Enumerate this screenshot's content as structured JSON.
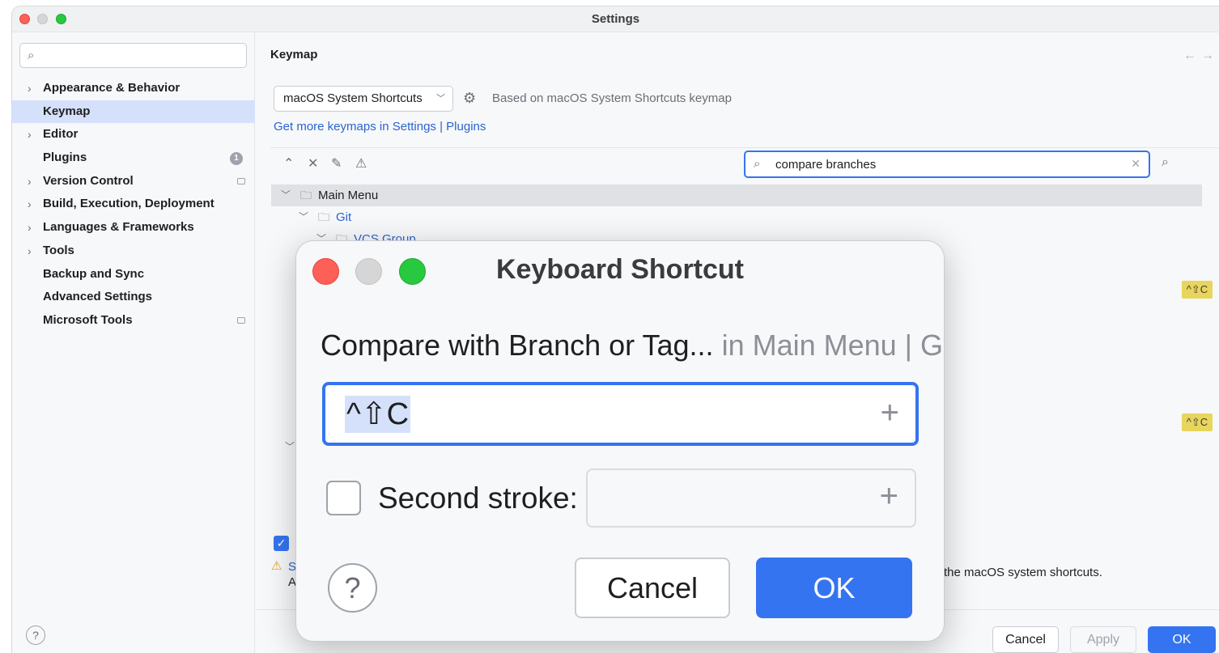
{
  "window": {
    "title": "Settings"
  },
  "sidebar": {
    "search_placeholder": "",
    "items": [
      {
        "label": "Appearance & Behavior",
        "expandable": true
      },
      {
        "label": "Keymap",
        "expandable": false,
        "selected": true
      },
      {
        "label": "Editor",
        "expandable": true
      },
      {
        "label": "Plugins",
        "expandable": false,
        "badge": "1"
      },
      {
        "label": "Version Control",
        "expandable": true
      },
      {
        "label": "Build, Execution, Deployment",
        "expandable": true
      },
      {
        "label": "Languages & Frameworks",
        "expandable": true
      },
      {
        "label": "Tools",
        "expandable": true
      },
      {
        "label": "Backup and Sync",
        "expandable": false
      },
      {
        "label": "Advanced Settings",
        "expandable": false
      },
      {
        "label": "Microsoft Tools",
        "expandable": false
      }
    ],
    "help_label": "?"
  },
  "main": {
    "title": "Keymap",
    "keymap_select": "macOS System Shortcuts",
    "based_on": "Based on macOS System Shortcuts keymap",
    "links": {
      "part1": "Get more keymaps in Settings",
      "sep": "|",
      "part2": "Plugins"
    },
    "filter_value": "compare branches",
    "tree": [
      {
        "label": "Main Menu",
        "level": 0
      },
      {
        "label": "Git",
        "level": 1
      },
      {
        "label": "VCS Group",
        "level": 2
      }
    ],
    "shortcut_chip_1": "^⇧C",
    "shortcut_chip_2": "^⇧C",
    "warning_prefix_s": "S",
    "warning_prefix_a": "A",
    "warning_text": "the macOS system shortcuts."
  },
  "footer": {
    "cancel": "Cancel",
    "apply": "Apply",
    "ok": "OK"
  },
  "dialog": {
    "title": "Keyboard Shortcut",
    "action_name": "Compare with Branch or Tag...",
    "action_context": " in Main Menu | G",
    "shortcut_value": "^⇧C",
    "second_stroke_label": "Second stroke:",
    "help": "?",
    "cancel": "Cancel",
    "ok": "OK"
  },
  "colors": {
    "accent": "#3574f0",
    "selection": "#d5e1fb",
    "chip": "#e8d55c",
    "link": "#2b64cc"
  }
}
